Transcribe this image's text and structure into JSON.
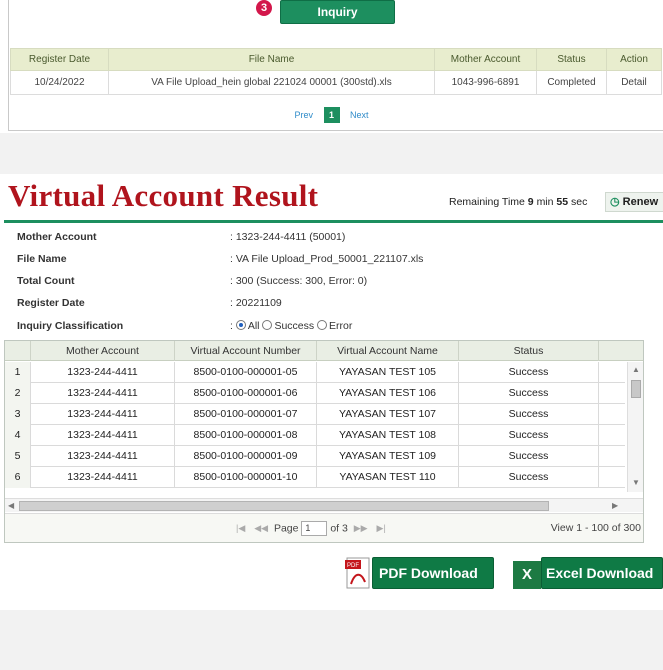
{
  "top": {
    "step_number": "3",
    "inquiry_label": "Inquiry",
    "columns": [
      "Register Date",
      "File Name",
      "Mother Account",
      "Status",
      "Action"
    ],
    "rows": [
      {
        "date": "10/24/2022",
        "file": "VA File Upload_hein global 221024 00001 (300std).xls",
        "account": "1043-996-6891",
        "status": "Completed",
        "action": "Detail"
      }
    ],
    "pager": {
      "prev": "Prev",
      "current": "1",
      "next": "Next"
    }
  },
  "result": {
    "title": "Virtual Account Result",
    "remaining_label": "Remaining Time",
    "remaining_min": "9",
    "min_label": "min",
    "remaining_sec": "55",
    "sec_label": "sec",
    "renew_label": "Renew",
    "info": {
      "mother_account_label": "Mother Account",
      "mother_account_value": ": 1323-244-4411 (50001)",
      "file_name_label": "File Name",
      "file_name_value": ": VA File Upload_Prod_50001_221107.xls",
      "total_count_label": "Total Count",
      "total_count_value": ": 300 (Success: 300, Error: 0)",
      "register_date_label": "Register Date",
      "register_date_value": ": 20221109",
      "inquiry_class_label": "Inquiry Classification",
      "options": [
        "All",
        "Success",
        "Error"
      ],
      "selected": "All"
    },
    "grid": {
      "columns": [
        "Mother Account",
        "Virtual Account Number",
        "Virtual Account Name",
        "Status"
      ],
      "rows": [
        {
          "n": "1",
          "mother": "1323-244-4411",
          "va": "8500-0100-000001-05",
          "name": "YAYASAN TEST 105",
          "status": "Success"
        },
        {
          "n": "2",
          "mother": "1323-244-4411",
          "va": "8500-0100-000001-06",
          "name": "YAYASAN TEST 106",
          "status": "Success"
        },
        {
          "n": "3",
          "mother": "1323-244-4411",
          "va": "8500-0100-000001-07",
          "name": "YAYASAN TEST 107",
          "status": "Success"
        },
        {
          "n": "4",
          "mother": "1323-244-4411",
          "va": "8500-0100-000001-08",
          "name": "YAYASAN TEST 108",
          "status": "Success"
        },
        {
          "n": "5",
          "mother": "1323-244-4411",
          "va": "8500-0100-000001-09",
          "name": "YAYASAN TEST 109",
          "status": "Success"
        },
        {
          "n": "6",
          "mother": "1323-244-4411",
          "va": "8500-0100-000001-10",
          "name": "YAYASAN TEST 110",
          "status": "Success"
        }
      ],
      "page_label": "Page",
      "page_value": "1",
      "of_label": "of 3",
      "view_info": "View 1 - 100 of 300"
    },
    "pdf_label": "PDF Download",
    "excel_label": "Excel Download",
    "pdf_icon_text": "PDF",
    "excel_icon_text": "X"
  }
}
